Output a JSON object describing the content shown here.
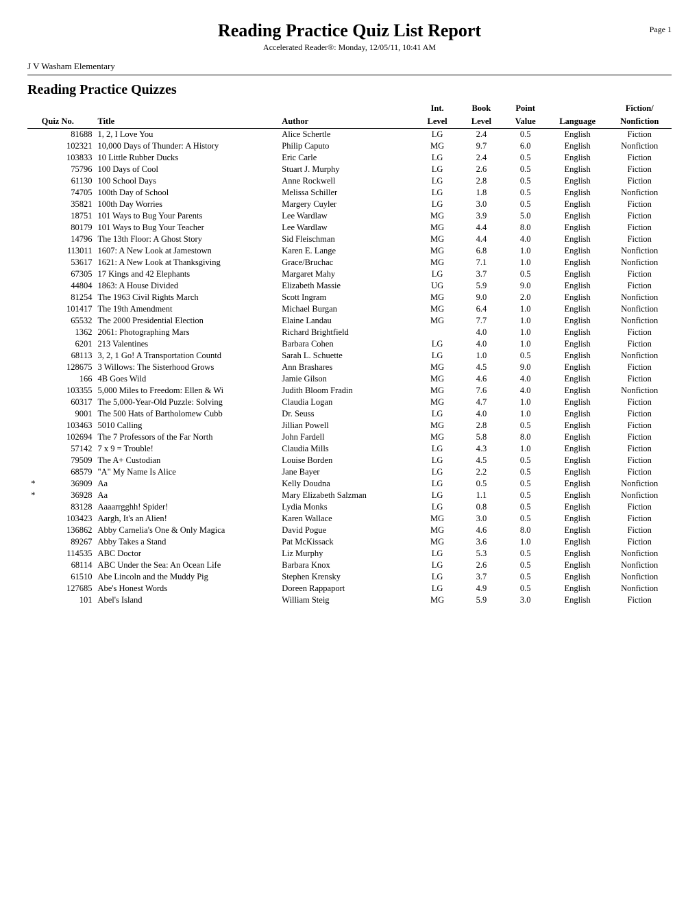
{
  "header": {
    "title": "Reading Practice Quiz List Report",
    "page_label": "Page 1",
    "subtitle": "Accelerated Reader®:  Monday, 12/05/11, 10:41 AM"
  },
  "school": "J V Washam Elementary",
  "section": {
    "title": "Reading Practice Quizzes",
    "columns": {
      "quiz_no": "Quiz No.",
      "title": "Title",
      "author": "Author",
      "int_level": "Int.",
      "int_level2": "Level",
      "book_level": "Book",
      "book_level2": "Level",
      "point_value": "Point",
      "point_value2": "Value",
      "language": "Language",
      "fiction": "Fiction/",
      "fiction2": "Nonfiction"
    }
  },
  "rows": [
    {
      "star": "",
      "quiz_no": "81688",
      "title": "1, 2, I Love You",
      "author": "Alice Schertle",
      "int_level": "LG",
      "book_level": "2.4",
      "point_value": "0.5",
      "language": "English",
      "fiction": "Fiction"
    },
    {
      "star": "",
      "quiz_no": "102321",
      "title": "10,000 Days of Thunder: A History",
      "author": "Philip Caputo",
      "int_level": "MG",
      "book_level": "9.7",
      "point_value": "6.0",
      "language": "English",
      "fiction": "Nonfiction"
    },
    {
      "star": "",
      "quiz_no": "103833",
      "title": "10 Little Rubber Ducks",
      "author": "Eric Carle",
      "int_level": "LG",
      "book_level": "2.4",
      "point_value": "0.5",
      "language": "English",
      "fiction": "Fiction"
    },
    {
      "star": "",
      "quiz_no": "75796",
      "title": "100 Days of Cool",
      "author": "Stuart J. Murphy",
      "int_level": "LG",
      "book_level": "2.6",
      "point_value": "0.5",
      "language": "English",
      "fiction": "Fiction"
    },
    {
      "star": "",
      "quiz_no": "61130",
      "title": "100 School Days",
      "author": "Anne Rockwell",
      "int_level": "LG",
      "book_level": "2.8",
      "point_value": "0.5",
      "language": "English",
      "fiction": "Fiction"
    },
    {
      "star": "",
      "quiz_no": "74705",
      "title": "100th Day of School",
      "author": "Melissa Schiller",
      "int_level": "LG",
      "book_level": "1.8",
      "point_value": "0.5",
      "language": "English",
      "fiction": "Nonfiction"
    },
    {
      "star": "",
      "quiz_no": "35821",
      "title": "100th Day Worries",
      "author": "Margery Cuyler",
      "int_level": "LG",
      "book_level": "3.0",
      "point_value": "0.5",
      "language": "English",
      "fiction": "Fiction"
    },
    {
      "star": "",
      "quiz_no": "18751",
      "title": "101 Ways to Bug Your Parents",
      "author": "Lee Wardlaw",
      "int_level": "MG",
      "book_level": "3.9",
      "point_value": "5.0",
      "language": "English",
      "fiction": "Fiction"
    },
    {
      "star": "",
      "quiz_no": "80179",
      "title": "101 Ways to Bug Your Teacher",
      "author": "Lee Wardlaw",
      "int_level": "MG",
      "book_level": "4.4",
      "point_value": "8.0",
      "language": "English",
      "fiction": "Fiction"
    },
    {
      "star": "",
      "quiz_no": "14796",
      "title": "The 13th Floor: A Ghost Story",
      "author": "Sid Fleischman",
      "int_level": "MG",
      "book_level": "4.4",
      "point_value": "4.0",
      "language": "English",
      "fiction": "Fiction"
    },
    {
      "star": "",
      "quiz_no": "113011",
      "title": "1607: A New Look at Jamestown",
      "author": "Karen E. Lange",
      "int_level": "MG",
      "book_level": "6.8",
      "point_value": "1.0",
      "language": "English",
      "fiction": "Nonfiction"
    },
    {
      "star": "",
      "quiz_no": "53617",
      "title": "1621: A New Look at Thanksgiving",
      "author": "Grace/Bruchac",
      "int_level": "MG",
      "book_level": "7.1",
      "point_value": "1.0",
      "language": "English",
      "fiction": "Nonfiction"
    },
    {
      "star": "",
      "quiz_no": "67305",
      "title": "17 Kings and 42 Elephants",
      "author": "Margaret Mahy",
      "int_level": "LG",
      "book_level": "3.7",
      "point_value": "0.5",
      "language": "English",
      "fiction": "Fiction"
    },
    {
      "star": "",
      "quiz_no": "44804",
      "title": "1863: A House Divided",
      "author": "Elizabeth Massie",
      "int_level": "UG",
      "book_level": "5.9",
      "point_value": "9.0",
      "language": "English",
      "fiction": "Fiction"
    },
    {
      "star": "",
      "quiz_no": "81254",
      "title": "The 1963 Civil Rights March",
      "author": "Scott Ingram",
      "int_level": "MG",
      "book_level": "9.0",
      "point_value": "2.0",
      "language": "English",
      "fiction": "Nonfiction"
    },
    {
      "star": "",
      "quiz_no": "101417",
      "title": "The 19th Amendment",
      "author": "Michael Burgan",
      "int_level": "MG",
      "book_level": "6.4",
      "point_value": "1.0",
      "language": "English",
      "fiction": "Nonfiction"
    },
    {
      "star": "",
      "quiz_no": "65532",
      "title": "The 2000 Presidential Election",
      "author": "Elaine Landau",
      "int_level": "MG",
      "book_level": "7.7",
      "point_value": "1.0",
      "language": "English",
      "fiction": "Nonfiction"
    },
    {
      "star": "",
      "quiz_no": "1362",
      "title": "2061: Photographing Mars",
      "author": "Richard Brightfield",
      "int_level": "",
      "book_level": "4.0",
      "point_value": "1.0",
      "language": "English",
      "fiction": "Fiction"
    },
    {
      "star": "",
      "quiz_no": "6201",
      "title": "213 Valentines",
      "author": "Barbara Cohen",
      "int_level": "LG",
      "book_level": "4.0",
      "point_value": "1.0",
      "language": "English",
      "fiction": "Fiction"
    },
    {
      "star": "",
      "quiz_no": "68113",
      "title": "3, 2, 1 Go! A Transportation Countd",
      "author": "Sarah L. Schuette",
      "int_level": "LG",
      "book_level": "1.0",
      "point_value": "0.5",
      "language": "English",
      "fiction": "Nonfiction"
    },
    {
      "star": "",
      "quiz_no": "128675",
      "title": "3 Willows: The Sisterhood Grows",
      "author": "Ann Brashares",
      "int_level": "MG",
      "book_level": "4.5",
      "point_value": "9.0",
      "language": "English",
      "fiction": "Fiction"
    },
    {
      "star": "",
      "quiz_no": "166",
      "title": "4B Goes Wild",
      "author": "Jamie Gilson",
      "int_level": "MG",
      "book_level": "4.6",
      "point_value": "4.0",
      "language": "English",
      "fiction": "Fiction"
    },
    {
      "star": "",
      "quiz_no": "103355",
      "title": "5,000 Miles to Freedom: Ellen & Wi",
      "author": "Judith Bloom Fradin",
      "int_level": "MG",
      "book_level": "7.6",
      "point_value": "4.0",
      "language": "English",
      "fiction": "Nonfiction"
    },
    {
      "star": "",
      "quiz_no": "60317",
      "title": "The 5,000-Year-Old Puzzle: Solving",
      "author": "Claudia Logan",
      "int_level": "MG",
      "book_level": "4.7",
      "point_value": "1.0",
      "language": "English",
      "fiction": "Fiction"
    },
    {
      "star": "",
      "quiz_no": "9001",
      "title": "The 500 Hats of Bartholomew Cubb",
      "author": "Dr. Seuss",
      "int_level": "LG",
      "book_level": "4.0",
      "point_value": "1.0",
      "language": "English",
      "fiction": "Fiction"
    },
    {
      "star": "",
      "quiz_no": "103463",
      "title": "5010 Calling",
      "author": "Jillian Powell",
      "int_level": "MG",
      "book_level": "2.8",
      "point_value": "0.5",
      "language": "English",
      "fiction": "Fiction"
    },
    {
      "star": "",
      "quiz_no": "102694",
      "title": "The 7 Professors of the Far North",
      "author": "John Fardell",
      "int_level": "MG",
      "book_level": "5.8",
      "point_value": "8.0",
      "language": "English",
      "fiction": "Fiction"
    },
    {
      "star": "",
      "quiz_no": "57142",
      "title": "7 x 9 = Trouble!",
      "author": "Claudia Mills",
      "int_level": "LG",
      "book_level": "4.3",
      "point_value": "1.0",
      "language": "English",
      "fiction": "Fiction"
    },
    {
      "star": "",
      "quiz_no": "79509",
      "title": "The A+ Custodian",
      "author": "Louise Borden",
      "int_level": "LG",
      "book_level": "4.5",
      "point_value": "0.5",
      "language": "English",
      "fiction": "Fiction"
    },
    {
      "star": "",
      "quiz_no": "68579",
      "title": "\"A\" My Name Is Alice",
      "author": "Jane Bayer",
      "int_level": "LG",
      "book_level": "2.2",
      "point_value": "0.5",
      "language": "English",
      "fiction": "Fiction"
    },
    {
      "star": "*",
      "quiz_no": "36909",
      "title": "Aa",
      "author": "Kelly Doudna",
      "int_level": "LG",
      "book_level": "0.5",
      "point_value": "0.5",
      "language": "English",
      "fiction": "Nonfiction"
    },
    {
      "star": "*",
      "quiz_no": "36928",
      "title": "Aa",
      "author": "Mary Elizabeth Salzman",
      "int_level": "LG",
      "book_level": "1.1",
      "point_value": "0.5",
      "language": "English",
      "fiction": "Nonfiction"
    },
    {
      "star": "",
      "quiz_no": "83128",
      "title": "Aaaarrgghh! Spider!",
      "author": "Lydia Monks",
      "int_level": "LG",
      "book_level": "0.8",
      "point_value": "0.5",
      "language": "English",
      "fiction": "Fiction"
    },
    {
      "star": "",
      "quiz_no": "103423",
      "title": "Aargh, It's an Alien!",
      "author": "Karen Wallace",
      "int_level": "MG",
      "book_level": "3.0",
      "point_value": "0.5",
      "language": "English",
      "fiction": "Fiction"
    },
    {
      "star": "",
      "quiz_no": "136862",
      "title": "Abby Carnelia's One & Only Magica",
      "author": "David Pogue",
      "int_level": "MG",
      "book_level": "4.6",
      "point_value": "8.0",
      "language": "English",
      "fiction": "Fiction"
    },
    {
      "star": "",
      "quiz_no": "89267",
      "title": "Abby Takes a Stand",
      "author": "Pat McKissack",
      "int_level": "MG",
      "book_level": "3.6",
      "point_value": "1.0",
      "language": "English",
      "fiction": "Fiction"
    },
    {
      "star": "",
      "quiz_no": "114535",
      "title": "ABC Doctor",
      "author": "Liz Murphy",
      "int_level": "LG",
      "book_level": "5.3",
      "point_value": "0.5",
      "language": "English",
      "fiction": "Nonfiction"
    },
    {
      "star": "",
      "quiz_no": "68114",
      "title": "ABC Under the Sea: An Ocean Life",
      "author": "Barbara Knox",
      "int_level": "LG",
      "book_level": "2.6",
      "point_value": "0.5",
      "language": "English",
      "fiction": "Nonfiction"
    },
    {
      "star": "",
      "quiz_no": "61510",
      "title": "Abe Lincoln and the Muddy Pig",
      "author": "Stephen Krensky",
      "int_level": "LG",
      "book_level": "3.7",
      "point_value": "0.5",
      "language": "English",
      "fiction": "Nonfiction"
    },
    {
      "star": "",
      "quiz_no": "127685",
      "title": "Abe's Honest Words",
      "author": "Doreen Rappaport",
      "int_level": "LG",
      "book_level": "4.9",
      "point_value": "0.5",
      "language": "English",
      "fiction": "Nonfiction"
    },
    {
      "star": "",
      "quiz_no": "101",
      "title": "Abel's Island",
      "author": "William Steig",
      "int_level": "MG",
      "book_level": "5.9",
      "point_value": "3.0",
      "language": "English",
      "fiction": "Fiction"
    }
  ]
}
